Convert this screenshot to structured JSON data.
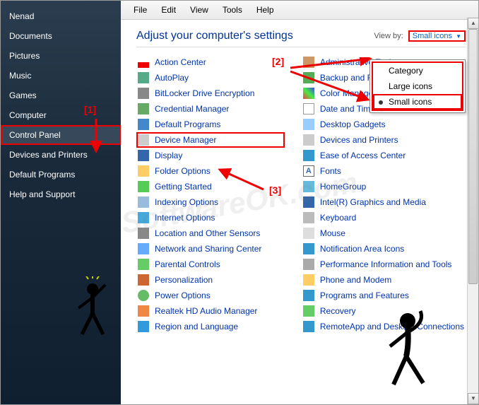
{
  "sidebar": {
    "items": [
      {
        "label": "Nenad"
      },
      {
        "label": "Documents"
      },
      {
        "label": "Pictures"
      },
      {
        "label": "Music"
      },
      {
        "label": "Games"
      },
      {
        "label": "Computer"
      },
      {
        "label": "Control Panel"
      },
      {
        "label": "Devices and Printers"
      },
      {
        "label": "Default Programs"
      },
      {
        "label": "Help and Support"
      }
    ],
    "highlighted_index": 6
  },
  "menubar": [
    "File",
    "Edit",
    "View",
    "Tools",
    "Help"
  ],
  "heading": "Adjust your computer's settings",
  "viewby": {
    "label": "View by:",
    "value": "Small icons"
  },
  "dropdown": {
    "items": [
      "Category",
      "Large icons",
      "Small icons"
    ],
    "selected_index": 2,
    "highlighted_index": 2
  },
  "annotations": {
    "n1": "[1]",
    "n2": "[2]",
    "n3": "[3]"
  },
  "watermark": "SoftwareOK.com",
  "columns": [
    [
      {
        "label": "Action Center",
        "icon": "ic-flag"
      },
      {
        "label": "AutoPlay",
        "icon": "ic-play"
      },
      {
        "label": "BitLocker Drive Encryption",
        "icon": "ic-lock"
      },
      {
        "label": "Credential Manager",
        "icon": "ic-cred"
      },
      {
        "label": "Default Programs",
        "icon": "ic-def"
      },
      {
        "label": "Device Manager",
        "icon": "ic-dev",
        "hl": true
      },
      {
        "label": "Display",
        "icon": "ic-disp"
      },
      {
        "label": "Folder Options",
        "icon": "ic-fold"
      },
      {
        "label": "Getting Started",
        "icon": "ic-start"
      },
      {
        "label": "Indexing Options",
        "icon": "ic-idx"
      },
      {
        "label": "Internet Options",
        "icon": "ic-ie"
      },
      {
        "label": "Location and Other Sensors",
        "icon": "ic-loc"
      },
      {
        "label": "Network and Sharing Center",
        "icon": "ic-net"
      },
      {
        "label": "Parental Controls",
        "icon": "ic-par"
      },
      {
        "label": "Personalization",
        "icon": "ic-pers"
      },
      {
        "label": "Power Options",
        "icon": "ic-pow"
      },
      {
        "label": "Realtek HD Audio Manager",
        "icon": "ic-hd"
      },
      {
        "label": "Region and Language",
        "icon": "ic-reg"
      }
    ],
    [
      {
        "label": "Administrative Tools",
        "icon": "ic-admin"
      },
      {
        "label": "Backup and Restore",
        "icon": "ic-bak"
      },
      {
        "label": "Color Management",
        "icon": "ic-color"
      },
      {
        "label": "Date and Time",
        "icon": "ic-date"
      },
      {
        "label": "Desktop Gadgets",
        "icon": "ic-gad"
      },
      {
        "label": "Devices and Printers",
        "icon": "ic-print"
      },
      {
        "label": "Ease of Access Center",
        "icon": "ic-ease"
      },
      {
        "label": "Fonts",
        "icon": "ic-font",
        "glyph": "A"
      },
      {
        "label": "HomeGroup",
        "icon": "ic-home"
      },
      {
        "label": "Intel(R) Graphics and Media",
        "icon": "ic-intel"
      },
      {
        "label": "Keyboard",
        "icon": "ic-kb"
      },
      {
        "label": "Mouse",
        "icon": "ic-mouse"
      },
      {
        "label": "Notification Area Icons",
        "icon": "ic-notif"
      },
      {
        "label": "Performance Information and Tools",
        "icon": "ic-perf"
      },
      {
        "label": "Phone and Modem",
        "icon": "ic-phone"
      },
      {
        "label": "Programs and Features",
        "icon": "ic-prog"
      },
      {
        "label": "Recovery",
        "icon": "ic-rec"
      },
      {
        "label": "RemoteApp and Desktop Connections",
        "icon": "ic-remote"
      }
    ]
  ]
}
